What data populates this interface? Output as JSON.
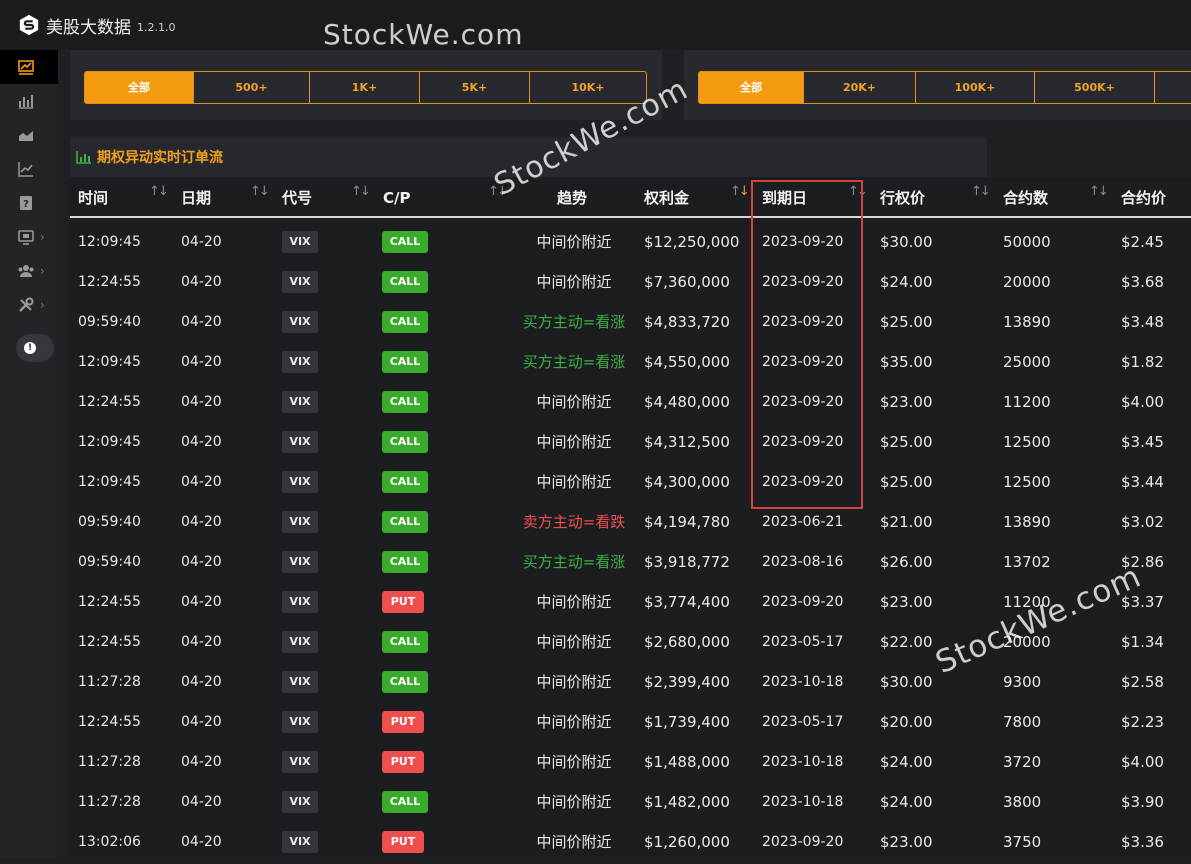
{
  "app": {
    "title": "美股大数据",
    "version": "1.2.1.0"
  },
  "watermark": "StockWe.com",
  "sidebar": {
    "icons": [
      "flow-icon",
      "chart-bar-icon",
      "chart-area-icon",
      "chart-line-icon",
      "help-icon",
      "monitor-icon",
      "users-icon",
      "tools-icon"
    ],
    "accent": "#f39c12"
  },
  "filters_left": [
    "全部",
    "500+",
    "1K+",
    "5K+",
    "10K+"
  ],
  "filters_right": [
    "全部",
    "20K+",
    "100K+",
    "500K+"
  ],
  "section_title": "期权异动实时订单流",
  "columns": [
    "时间",
    "日期",
    "代号",
    "C/P",
    "趋势",
    "权利金",
    "到期日",
    "行权价",
    "合约数",
    "合约价"
  ],
  "rows": [
    {
      "time": "12:09:45",
      "date": "04-20",
      "ticker": "VIX",
      "cp": "CALL",
      "trend": "中间价附近",
      "premium": "$12,250,000",
      "expiry": "2023-09-20",
      "strike": "$30.00",
      "contracts": "50000",
      "price": "$2.45"
    },
    {
      "time": "12:24:55",
      "date": "04-20",
      "ticker": "VIX",
      "cp": "CALL",
      "trend": "中间价附近",
      "premium": "$7,360,000",
      "expiry": "2023-09-20",
      "strike": "$24.00",
      "contracts": "20000",
      "price": "$3.68"
    },
    {
      "time": "09:59:40",
      "date": "04-20",
      "ticker": "VIX",
      "cp": "CALL",
      "trend": "买方主动=看涨",
      "premium": "$4,833,720",
      "expiry": "2023-09-20",
      "strike": "$25.00",
      "contracts": "13890",
      "price": "$3.48"
    },
    {
      "time": "12:09:45",
      "date": "04-20",
      "ticker": "VIX",
      "cp": "CALL",
      "trend": "买方主动=看涨",
      "premium": "$4,550,000",
      "expiry": "2023-09-20",
      "strike": "$35.00",
      "contracts": "25000",
      "price": "$1.82"
    },
    {
      "time": "12:24:55",
      "date": "04-20",
      "ticker": "VIX",
      "cp": "CALL",
      "trend": "中间价附近",
      "premium": "$4,480,000",
      "expiry": "2023-09-20",
      "strike": "$23.00",
      "contracts": "11200",
      "price": "$4.00"
    },
    {
      "time": "12:09:45",
      "date": "04-20",
      "ticker": "VIX",
      "cp": "CALL",
      "trend": "中间价附近",
      "premium": "$4,312,500",
      "expiry": "2023-09-20",
      "strike": "$25.00",
      "contracts": "12500",
      "price": "$3.45"
    },
    {
      "time": "12:09:45",
      "date": "04-20",
      "ticker": "VIX",
      "cp": "CALL",
      "trend": "中间价附近",
      "premium": "$4,300,000",
      "expiry": "2023-09-20",
      "strike": "$25.00",
      "contracts": "12500",
      "price": "$3.44"
    },
    {
      "time": "09:59:40",
      "date": "04-20",
      "ticker": "VIX",
      "cp": "CALL",
      "trend": "卖方主动=看跌",
      "premium": "$4,194,780",
      "expiry": "2023-06-21",
      "strike": "$21.00",
      "contracts": "13890",
      "price": "$3.02"
    },
    {
      "time": "09:59:40",
      "date": "04-20",
      "ticker": "VIX",
      "cp": "CALL",
      "trend": "买方主动=看涨",
      "premium": "$3,918,772",
      "expiry": "2023-08-16",
      "strike": "$26.00",
      "contracts": "13702",
      "price": "$2.86"
    },
    {
      "time": "12:24:55",
      "date": "04-20",
      "ticker": "VIX",
      "cp": "PUT",
      "trend": "中间价附近",
      "premium": "$3,774,400",
      "expiry": "2023-09-20",
      "strike": "$23.00",
      "contracts": "11200",
      "price": "$3.37"
    },
    {
      "time": "12:24:55",
      "date": "04-20",
      "ticker": "VIX",
      "cp": "CALL",
      "trend": "中间价附近",
      "premium": "$2,680,000",
      "expiry": "2023-05-17",
      "strike": "$22.00",
      "contracts": "20000",
      "price": "$1.34"
    },
    {
      "time": "11:27:28",
      "date": "04-20",
      "ticker": "VIX",
      "cp": "CALL",
      "trend": "中间价附近",
      "premium": "$2,399,400",
      "expiry": "2023-10-18",
      "strike": "$30.00",
      "contracts": "9300",
      "price": "$2.58"
    },
    {
      "time": "12:24:55",
      "date": "04-20",
      "ticker": "VIX",
      "cp": "PUT",
      "trend": "中间价附近",
      "premium": "$1,739,400",
      "expiry": "2023-05-17",
      "strike": "$20.00",
      "contracts": "7800",
      "price": "$2.23"
    },
    {
      "time": "11:27:28",
      "date": "04-20",
      "ticker": "VIX",
      "cp": "PUT",
      "trend": "中间价附近",
      "premium": "$1,488,000",
      "expiry": "2023-10-18",
      "strike": "$24.00",
      "contracts": "3720",
      "price": "$4.00"
    },
    {
      "time": "11:27:28",
      "date": "04-20",
      "ticker": "VIX",
      "cp": "CALL",
      "trend": "中间价附近",
      "premium": "$1,482,000",
      "expiry": "2023-10-18",
      "strike": "$24.00",
      "contracts": "3800",
      "price": "$3.90"
    },
    {
      "time": "13:02:06",
      "date": "04-20",
      "ticker": "VIX",
      "cp": "PUT",
      "trend": "中间价附近",
      "premium": "$1,260,000",
      "expiry": "2023-09-20",
      "strike": "$23.00",
      "contracts": "3750",
      "price": "$3.36"
    }
  ],
  "colors": {
    "call": "#3aab2c",
    "put": "#ef4e4e",
    "bullish": "#3cb043",
    "bearish": "#ef4e4e",
    "neutral": "#eaeaea",
    "highlight": "#d2453f"
  }
}
